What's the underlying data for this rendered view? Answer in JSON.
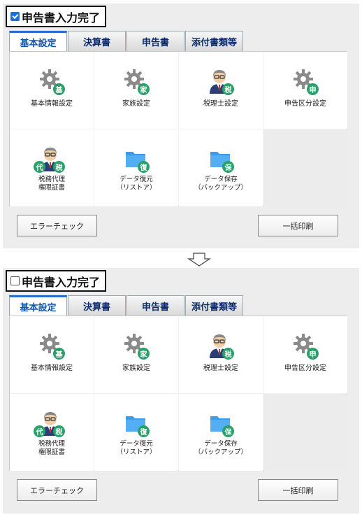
{
  "panels": [
    {
      "complete_label": "申告書入力完了",
      "checked": true,
      "tabs": [
        "基本設定",
        "決算書",
        "申告書",
        "添付書類等"
      ],
      "tiles": [
        {
          "label": "基本情報設定",
          "icon": "gear-icon",
          "badge": "基"
        },
        {
          "label": "家族設定",
          "icon": "gear-icon",
          "badge": "家"
        },
        {
          "label": "税理士設定",
          "icon": "person-icon",
          "badge": "税"
        },
        {
          "label": "申告区分設定",
          "icon": "gear-icon",
          "badge": "申"
        },
        {
          "label_line1": "税務代理",
          "label_line2": "権限証書",
          "icon": "person-icon",
          "badge_left": "代",
          "badge": "税"
        },
        {
          "label_line1": "データ復元",
          "label_line2": "（リストア）",
          "icon": "folder-icon",
          "badge": "復"
        },
        {
          "label_line1": "データ保存",
          "label_line2": "（バックアップ）",
          "icon": "folder-icon",
          "badge": "保"
        }
      ],
      "error_check_label": "エラーチェック",
      "bulk_print_label": "一括印刷"
    },
    {
      "complete_label": "申告書入力完了",
      "checked": false,
      "tabs": [
        "基本設定",
        "決算書",
        "申告書",
        "添付書類等"
      ],
      "tiles": [
        {
          "label": "基本情報設定",
          "icon": "gear-icon",
          "badge": "基"
        },
        {
          "label": "家族設定",
          "icon": "gear-icon",
          "badge": "家"
        },
        {
          "label": "税理士設定",
          "icon": "person-icon",
          "badge": "税"
        },
        {
          "label": "申告区分設定",
          "icon": "gear-icon",
          "badge": "申"
        },
        {
          "label_line1": "税務代理",
          "label_line2": "権限証書",
          "icon": "person-icon",
          "badge_left": "代",
          "badge": "税"
        },
        {
          "label_line1": "データ復元",
          "label_line2": "（リストア）",
          "icon": "folder-icon",
          "badge": "復"
        },
        {
          "label_line1": "データ保存",
          "label_line2": "（バックアップ）",
          "icon": "folder-icon",
          "badge": "保"
        }
      ],
      "error_check_label": "エラーチェック",
      "bulk_print_label": "一括印刷"
    }
  ],
  "colors": {
    "accent": "#2a6cc7",
    "tab_text": "#0b2a6e",
    "badge": "#2aa06a",
    "folder": "#3d9be9",
    "gear": "#8a8a8a"
  }
}
